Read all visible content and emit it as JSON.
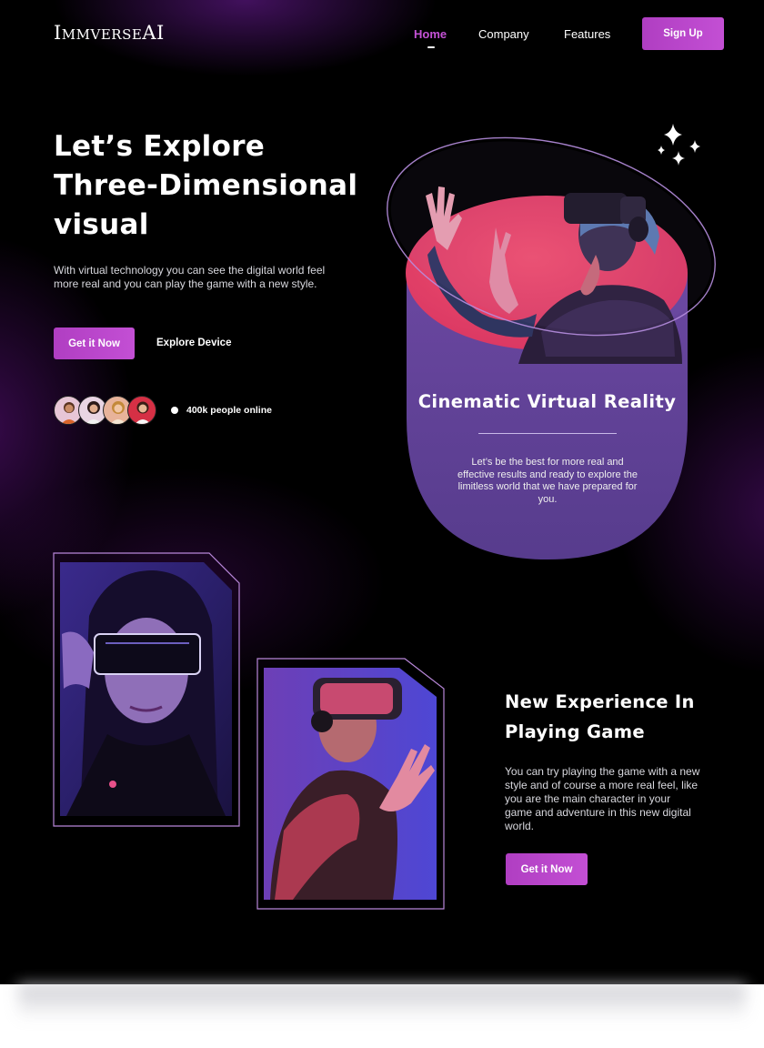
{
  "nav": {
    "logo": "ImmverseAI",
    "home": "Home",
    "company": "Company",
    "features": "Features",
    "signup": "Sign Up"
  },
  "hero": {
    "title_line1": "Let’s Explore",
    "title_line2": "Three-Dimensional",
    "title_line3": "visual",
    "description": "With virtual technology you can see the digital world feel more real and you can play the game with a new style.",
    "cta_primary": "Get it Now",
    "cta_secondary": "Explore Device",
    "online_text": "400k people online"
  },
  "card": {
    "title": "Cinematic Virtual Reality",
    "description": "Let’s be the best for more real and effective results and ready to explore the limitless world that we have prepared for you."
  },
  "section2": {
    "title": "New Experience In Playing Game",
    "description": "You can try playing the game with a new style and of course a more real feel, like you are the main character in your game and adventure in this new digital world.",
    "cta": "Get it Now"
  },
  "colors": {
    "accent": "#c34fd4",
    "card": "#5b3f8f",
    "pink": "#e8416a"
  }
}
